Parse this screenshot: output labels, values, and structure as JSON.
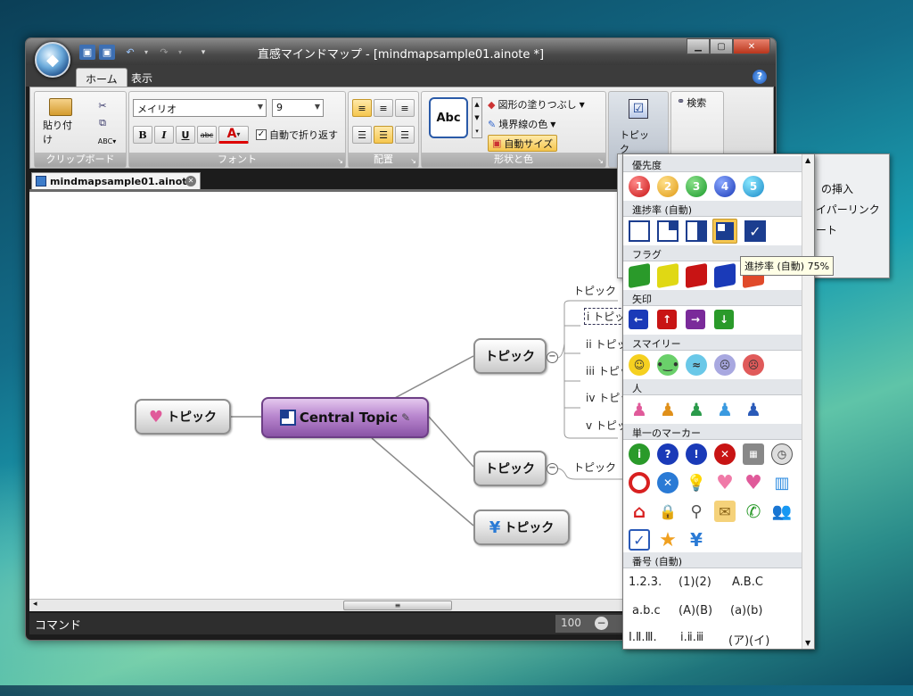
{
  "window": {
    "title": "直感マインドマップ - [mindmapsample01.ainote *]",
    "tabs": [
      "ホーム",
      "表示"
    ]
  },
  "ribbon": {
    "clipboard": {
      "paste": "貼り付け",
      "label": "クリップボード"
    },
    "font": {
      "family": "メイリオ",
      "size": "9",
      "wrap": "自動で折り返す",
      "label": "フォント",
      "bold": "B",
      "italic": "I",
      "underline": "U",
      "strike": "abc",
      "color": "A"
    },
    "align": {
      "label": "配置"
    },
    "shape": {
      "style": "Abc",
      "fill": "図形の塗りつぶし",
      "border": "境界線の色",
      "autosize": "自動サイズ",
      "label": "形状と色"
    },
    "topic": {
      "label": "トピック"
    },
    "search": {
      "label": "検索"
    }
  },
  "document": {
    "tab": "mindmapsample01.ainote *"
  },
  "mindmap": {
    "central": "Central Topic",
    "left": "トピック",
    "right1": "トピック",
    "right2": "トピック",
    "right3": "トピック",
    "right1_header": "トピック",
    "right1_children": [
      "i トピック",
      "ii トピック",
      "iii トピック",
      "iv トピック",
      "v トピック"
    ],
    "right2_child": "トピック"
  },
  "status": {
    "command": "コマンド",
    "zoom": "100"
  },
  "panel": {
    "sections": [
      "優先度",
      "進捗率 (自動)",
      "フラグ",
      "矢印",
      "スマイリー",
      "人",
      "単一のマーカー",
      "番号 (自動)"
    ],
    "priority": [
      "1",
      "2",
      "3",
      "4",
      "5"
    ],
    "numbering": [
      [
        "1.2.3.",
        "(1)(2)",
        "A.B.C"
      ],
      [
        "a.b.c",
        "(A)(B)",
        "(a)(b)"
      ],
      [
        "Ⅰ.Ⅱ.Ⅲ.",
        "ⅰ.ⅱ.ⅲ",
        "(ア)(イ)"
      ]
    ],
    "behind_menu": [
      "の挿入",
      "イパーリンク",
      "ート"
    ],
    "tooltip": "進捗率 (自動) 75%"
  }
}
